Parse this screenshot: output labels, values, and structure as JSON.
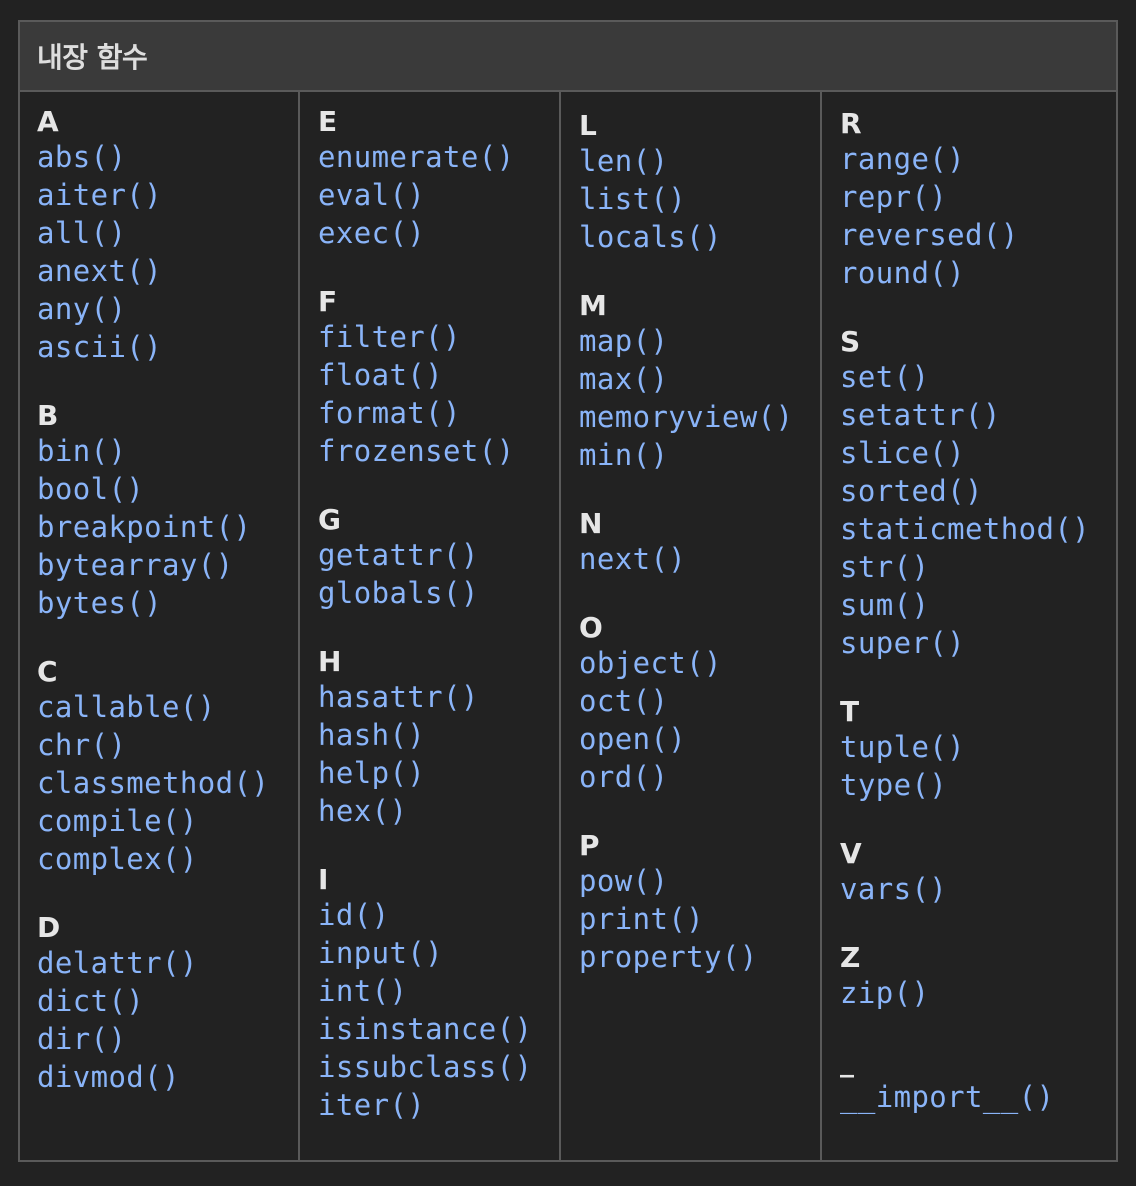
{
  "header": {
    "title": "내장 함수"
  },
  "columns": [
    {
      "groups": [
        {
          "letter": "A",
          "functions": [
            "abs()",
            "aiter()",
            "all()",
            "anext()",
            "any()",
            "ascii()"
          ]
        },
        {
          "letter": "B",
          "functions": [
            "bin()",
            "bool()",
            "breakpoint()",
            "bytearray()",
            "bytes()"
          ]
        },
        {
          "letter": "C",
          "functions": [
            "callable()",
            "chr()",
            "classmethod()",
            "compile()",
            "complex()"
          ]
        },
        {
          "letter": "D",
          "functions": [
            "delattr()",
            "dict()",
            "dir()",
            "divmod()"
          ]
        }
      ]
    },
    {
      "groups": [
        {
          "letter": "E",
          "functions": [
            "enumerate()",
            "eval()",
            "exec()"
          ]
        },
        {
          "letter": "F",
          "functions": [
            "filter()",
            "float()",
            "format()",
            "frozenset()"
          ]
        },
        {
          "letter": "G",
          "functions": [
            "getattr()",
            "globals()"
          ]
        },
        {
          "letter": "H",
          "functions": [
            "hasattr()",
            "hash()",
            "help()",
            "hex()"
          ]
        },
        {
          "letter": "I",
          "functions": [
            "id()",
            "input()",
            "int()",
            "isinstance()",
            "issubclass()",
            "iter()"
          ]
        }
      ]
    },
    {
      "groups": [
        {
          "letter": "L",
          "functions": [
            "len()",
            "list()",
            "locals()"
          ]
        },
        {
          "letter": "M",
          "functions": [
            "map()",
            "max()",
            "memoryview()",
            "min()"
          ]
        },
        {
          "letter": "N",
          "functions": [
            "next()"
          ]
        },
        {
          "letter": "O",
          "functions": [
            "object()",
            "oct()",
            "open()",
            "ord()"
          ]
        },
        {
          "letter": "P",
          "functions": [
            "pow()",
            "print()",
            "property()"
          ]
        }
      ]
    },
    {
      "groups": [
        {
          "letter": "R",
          "functions": [
            "range()",
            "repr()",
            "reversed()",
            "round()"
          ]
        },
        {
          "letter": "S",
          "functions": [
            "set()",
            "setattr()",
            "slice()",
            "sorted()",
            "staticmethod()",
            "str()",
            "sum()",
            "super()"
          ]
        },
        {
          "letter": "T",
          "functions": [
            "tuple()",
            "type()"
          ]
        },
        {
          "letter": "V",
          "functions": [
            "vars()"
          ]
        },
        {
          "letter": "Z",
          "functions": [
            "zip()"
          ]
        },
        {
          "letter": "_",
          "functions": [
            "__import__()"
          ]
        }
      ]
    }
  ]
}
